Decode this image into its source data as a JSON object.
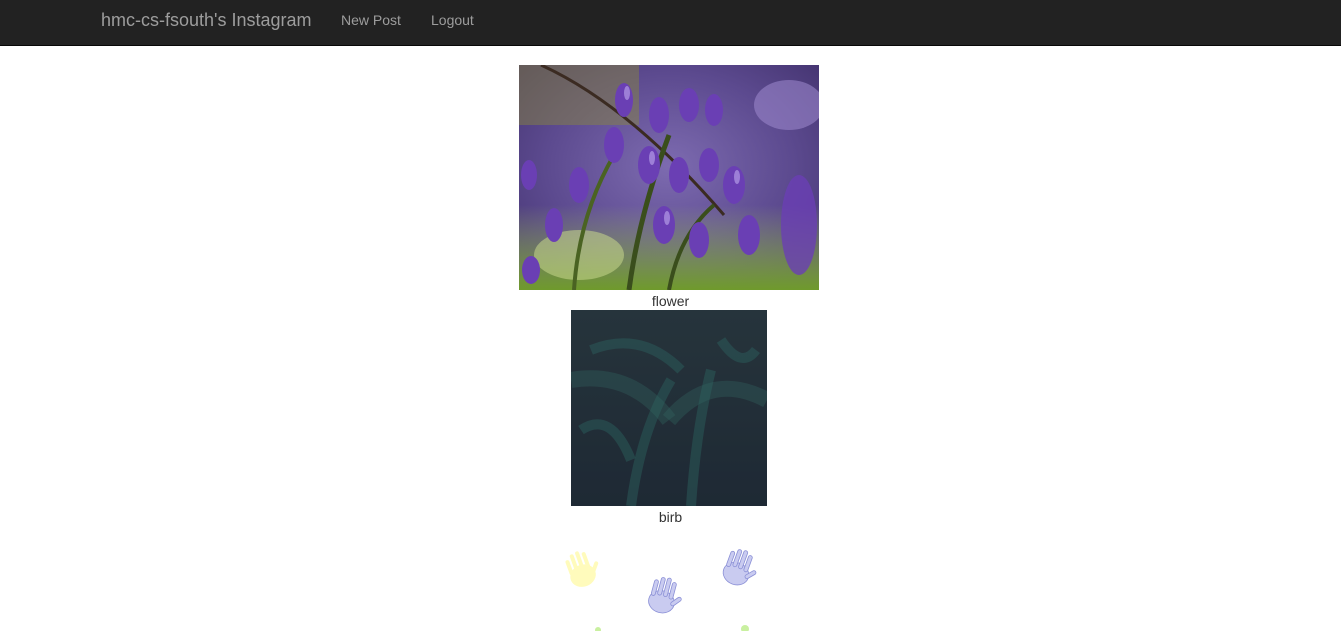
{
  "navbar": {
    "brand": "hmc-cs-fsouth's Instagram",
    "links": [
      {
        "label": "New Post"
      },
      {
        "label": "Logout"
      }
    ]
  },
  "posts": [
    {
      "image_icon": "bluebell-flower-photo",
      "caption": "flower"
    },
    {
      "image_icon": "dark-teal-texture-photo",
      "caption": "birb"
    },
    {
      "image_icon": "colored-handprints-image",
      "caption": ""
    }
  ],
  "colors": {
    "navbar_bg": "#222222",
    "navbar_text": "#9d9d9d",
    "caption_text": "#333333"
  }
}
